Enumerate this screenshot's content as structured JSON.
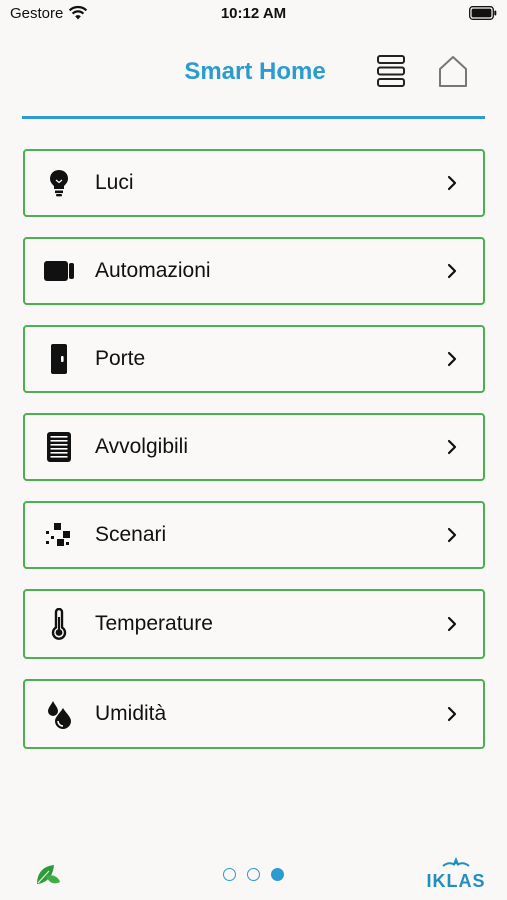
{
  "status_bar": {
    "carrier": "Gestore",
    "time": "10:12 AM"
  },
  "header": {
    "title": "Smart Home",
    "menu_icon": "menu-icon",
    "home_icon": "home-icon"
  },
  "menu": {
    "items": [
      {
        "label": "Luci",
        "icon": "bulb-icon"
      },
      {
        "label": "Automazioni",
        "icon": "automation-icon"
      },
      {
        "label": "Porte",
        "icon": "door-icon"
      },
      {
        "label": "Avvolgibili",
        "icon": "shutter-icon"
      },
      {
        "label": "Scenari",
        "icon": "scenario-icon"
      },
      {
        "label": "Temperature",
        "icon": "thermometer-icon"
      },
      {
        "label": "Umidità",
        "icon": "humidity-icon"
      }
    ]
  },
  "footer": {
    "brand": "IKLAS",
    "page_count": 3,
    "active_page": 3
  },
  "colors": {
    "accent": "#2b9bd0",
    "card_border": "#4caf50",
    "background": "#f9f8f6"
  }
}
